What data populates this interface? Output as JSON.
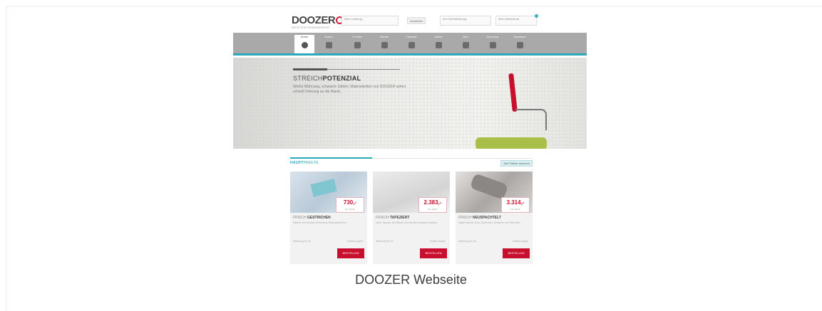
{
  "site": {
    "logo": "DOOZER",
    "logo_sub": "MEISTER HANDWERKER",
    "location_box": "Mein Leistung",
    "login_btn": "Anmelden",
    "service_box": "Ihre Dienstleistung",
    "cart_box": "Mein Warenkorb",
    "nav": [
      {
        "label": "Home",
        "icon": "home-icon"
      },
      {
        "label": "Boden",
        "icon": "floor-icon"
      },
      {
        "label": "Fenster",
        "icon": "window-icon"
      },
      {
        "label": "Wände",
        "icon": "wall-icon"
      },
      {
        "label": "Fassade",
        "icon": "facade-icon"
      },
      {
        "label": "Möbel",
        "icon": "furniture-icon"
      },
      {
        "label": "Bad",
        "icon": "bath-icon"
      },
      {
        "label": "Wohnung",
        "icon": "apartment-icon"
      },
      {
        "label": "Sonstiges",
        "icon": "misc-icon"
      }
    ],
    "hero": {
      "title_light": "STREICH",
      "title_bold": "POTENZIAL",
      "text": "Weiße Wohnung, schwarze Zahlen: Malerarbeiten von DOOZER sehen schnell Ordnung an die Wand."
    },
    "section": {
      "title_bold": "HAUPT",
      "title_light": "PAKETE",
      "link": "Alle Pakete ansehen"
    },
    "cards": [
      {
        "title_light": "FRISCH ",
        "title_bold": "GESTRICHEN",
        "price": "730,-",
        "price_sub": "inkl. MwSt.",
        "desc": "Wände und Decken in frischem Weiß gestrichen.",
        "opt_left": "Wohnung 60 m²",
        "opt_right": "Details zeigen",
        "button": "BESTELLEN"
      },
      {
        "title_light": "FRISCH ",
        "title_bold": "TAPEZIERT",
        "price": "2.383,-",
        "price_sub": "inkl. MwSt.",
        "desc": "Neue Tapeten für Wände und Decken inklusive Anstrich.",
        "opt_left": "Wohnung 60 m²",
        "opt_right": "Details zeigen",
        "button": "BESTELLEN"
      },
      {
        "title_light": "FRISCH ",
        "title_bold": "NEUSPACHTELT",
        "price": "3.314,-",
        "price_sub": "inkl. MwSt.",
        "desc": "Glatte Wände durch Spachteln, Schleifen und Streichen.",
        "opt_left": "Wohnung 60 m²",
        "opt_right": "Details zeigen",
        "button": "BESTELLEN"
      }
    ]
  },
  "caption": "DOOZER Webseite",
  "colors": {
    "brand_red": "#c8102e",
    "accent_teal": "#2aa9bb",
    "nav_gray": "#a9a9a9"
  }
}
